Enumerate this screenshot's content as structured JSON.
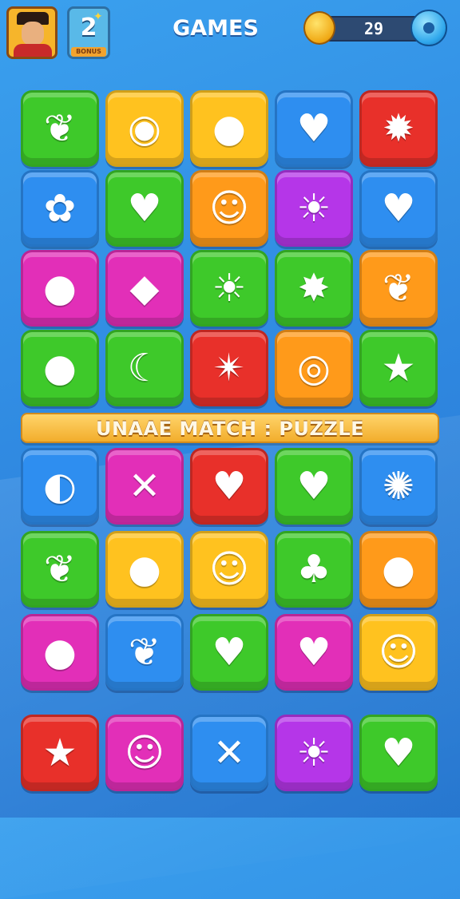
{
  "header": {
    "title": "GAMES",
    "level_number": "2",
    "level_label": "BONUS",
    "coins": "29"
  },
  "banner": {
    "text": "UNAAE MATCH : PUZZLE"
  },
  "colors": {
    "green": "#3ec92a",
    "yellow": "#ffc21f",
    "blue": "#2e8ef0",
    "red": "#e8302a",
    "purple": "#b536e8",
    "magenta": "#e22fb8",
    "orange": "#ff9a1a",
    "banner": "#f2ad2c"
  },
  "rows": [
    [
      {
        "icon": "leaf-icon",
        "glyph": "❦",
        "color": "green"
      },
      {
        "icon": "ghost-icon",
        "glyph": "◉",
        "color": "yellow"
      },
      {
        "icon": "lemon-icon",
        "glyph": "●",
        "color": "yellow"
      },
      {
        "icon": "heart-icon",
        "glyph": "♥",
        "color": "blue"
      },
      {
        "icon": "splat-icon",
        "glyph": "✹",
        "color": "red"
      }
    ],
    [
      {
        "icon": "candy-icon",
        "glyph": "✿",
        "color": "blue"
      },
      {
        "icon": "heart-pin-icon",
        "glyph": "♥",
        "color": "green"
      },
      {
        "icon": "smiley-icon",
        "glyph": "☺",
        "color": "orange"
      },
      {
        "icon": "sun-icon",
        "glyph": "☀",
        "color": "purple"
      },
      {
        "icon": "heart-icon",
        "glyph": "♥",
        "color": "blue"
      }
    ],
    [
      {
        "icon": "lemon-icon",
        "glyph": "●",
        "color": "magenta"
      },
      {
        "icon": "gem-icon",
        "glyph": "◆",
        "color": "magenta"
      },
      {
        "icon": "sun-face-icon",
        "glyph": "☀",
        "color": "green"
      },
      {
        "icon": "blob-icon",
        "glyph": "✸",
        "color": "green"
      },
      {
        "icon": "leaf-icon",
        "glyph": "❦",
        "color": "orange"
      }
    ],
    [
      {
        "icon": "apple-icon",
        "glyph": "●",
        "color": "green"
      },
      {
        "icon": "eggplant-icon",
        "glyph": "☾",
        "color": "green"
      },
      {
        "icon": "star-burst-icon",
        "glyph": "✴",
        "color": "red"
      },
      {
        "icon": "spiral-icon",
        "glyph": "◎",
        "color": "orange"
      },
      {
        "icon": "star-arrow-icon",
        "glyph": "★",
        "color": "green"
      }
    ],
    [
      {
        "icon": "planet-icon",
        "glyph": "◐",
        "color": "blue"
      },
      {
        "icon": "tools-icon",
        "glyph": "✕",
        "color": "magenta"
      },
      {
        "icon": "heart-badge-icon",
        "glyph": "♥",
        "color": "red"
      },
      {
        "icon": "heart-icon",
        "glyph": "♥",
        "color": "green"
      },
      {
        "icon": "virus-icon",
        "glyph": "✺",
        "color": "blue"
      }
    ],
    [
      {
        "icon": "leaf-icon",
        "glyph": "❦",
        "color": "green"
      },
      {
        "icon": "bubble-icon",
        "glyph": "●",
        "color": "yellow"
      },
      {
        "icon": "smiley-block-icon",
        "glyph": "☺",
        "color": "yellow"
      },
      {
        "icon": "clover-icon",
        "glyph": "♣",
        "color": "green"
      },
      {
        "icon": "apple-icon",
        "glyph": "●",
        "color": "orange"
      }
    ],
    [
      {
        "icon": "apple-icon",
        "glyph": "●",
        "color": "magenta"
      },
      {
        "icon": "leaf-icon",
        "glyph": "❦",
        "color": "blue"
      },
      {
        "icon": "heart-icon",
        "glyph": "♥",
        "color": "green"
      },
      {
        "icon": "heart-icon",
        "glyph": "♥",
        "color": "magenta"
      },
      {
        "icon": "smiley-icon",
        "glyph": "☺",
        "color": "yellow"
      }
    ],
    [
      {
        "icon": "star-icon",
        "glyph": "★",
        "color": "red"
      },
      {
        "icon": "smiley-icon",
        "glyph": "☺",
        "color": "magenta"
      },
      {
        "icon": "sword-icon",
        "glyph": "✕",
        "color": "blue"
      },
      {
        "icon": "sun-icon",
        "glyph": "☀",
        "color": "purple"
      },
      {
        "icon": "heart-icon",
        "glyph": "♥",
        "color": "green"
      }
    ]
  ]
}
